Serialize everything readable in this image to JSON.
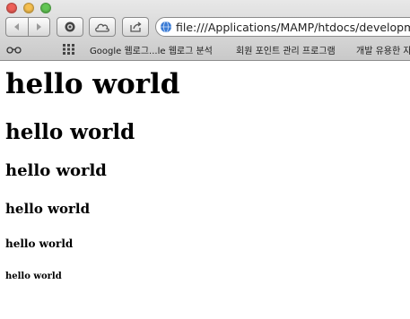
{
  "colors": {
    "close": "#ee5f57",
    "minimize": "#f5bf4f",
    "zoom": "#62c654",
    "globe": "#3a7bd5"
  },
  "toolbar": {
    "url": "file:///Applications/MAMP/htdocs/developm"
  },
  "bookmarks": {
    "items": [
      {
        "label": "Google 웹로그...le 웹로그 분석"
      },
      {
        "label": "회원 포인트 관리 프로그램"
      },
      {
        "label": "개발 유용한 자"
      }
    ]
  },
  "page": {
    "headings": [
      "hello world",
      "hello world",
      "hello world",
      "hello world",
      "hello world",
      "hello world"
    ]
  }
}
